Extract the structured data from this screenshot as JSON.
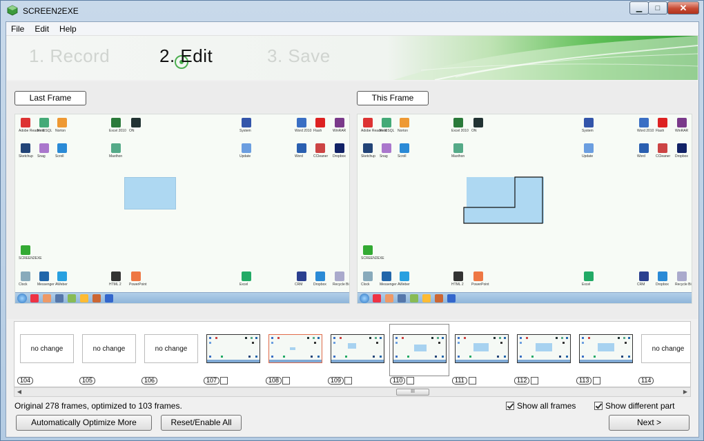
{
  "window": {
    "title": "SCREEN2EXE",
    "minimize": "▁",
    "maximize": "□",
    "close": "✕"
  },
  "menu": [
    "File",
    "Edit",
    "Help"
  ],
  "steps": [
    "1. Record",
    "2. Edit",
    "3. Save"
  ],
  "labels": {
    "last_frame": "Last Frame",
    "this_frame": "This Frame"
  },
  "frames": [
    {
      "num": "104",
      "content": "no change",
      "check": false
    },
    {
      "num": "105",
      "content": "no change",
      "check": false
    },
    {
      "num": "106",
      "content": "no change",
      "check": false
    },
    {
      "num": "107",
      "content": "",
      "check": true
    },
    {
      "num": "108",
      "content": "",
      "check": true
    },
    {
      "num": "109",
      "content": "",
      "check": true
    },
    {
      "num": "110",
      "content": "",
      "check": true
    },
    {
      "num": "111",
      "content": "",
      "check": true
    },
    {
      "num": "112",
      "content": "",
      "check": true
    },
    {
      "num": "113",
      "content": "",
      "check": true
    },
    {
      "num": "114",
      "content": "no change",
      "check": false
    }
  ],
  "selected_frame": "110",
  "scroll": {
    "left": "◀",
    "right": "▶",
    "grip": "III"
  },
  "status": "Original 278 frames, optimized to 103 frames.",
  "options": {
    "show_all_frames": "Show all frames",
    "show_different_part": "Show different part"
  },
  "buttons": {
    "auto_optimize": "Automatically Optimize More",
    "reset_enable": "Reset/Enable All",
    "next": "Next >"
  },
  "desktop_icon_labels": [
    "Adobe Reader X",
    "HeidiSQL",
    "Norton",
    "Excel 2010",
    "ON",
    "System",
    "Word 2010",
    "Flash",
    "WinRAR",
    "Sketchup",
    "Snag",
    "Scroll",
    "Maxthon",
    "Update",
    "Word",
    "CCleaner",
    "Dropbox",
    "SCREEN2EXE",
    "Clock",
    "Messenger",
    "AWeber",
    "HTML 2",
    "PowerPoint",
    "Excel",
    "CRM",
    "Dropbox",
    "Recycle Bin"
  ],
  "colors": {
    "banner_green": "#2e9d32",
    "selection_blue": "#aed8f2",
    "window_frame": "#b3cbe3"
  }
}
